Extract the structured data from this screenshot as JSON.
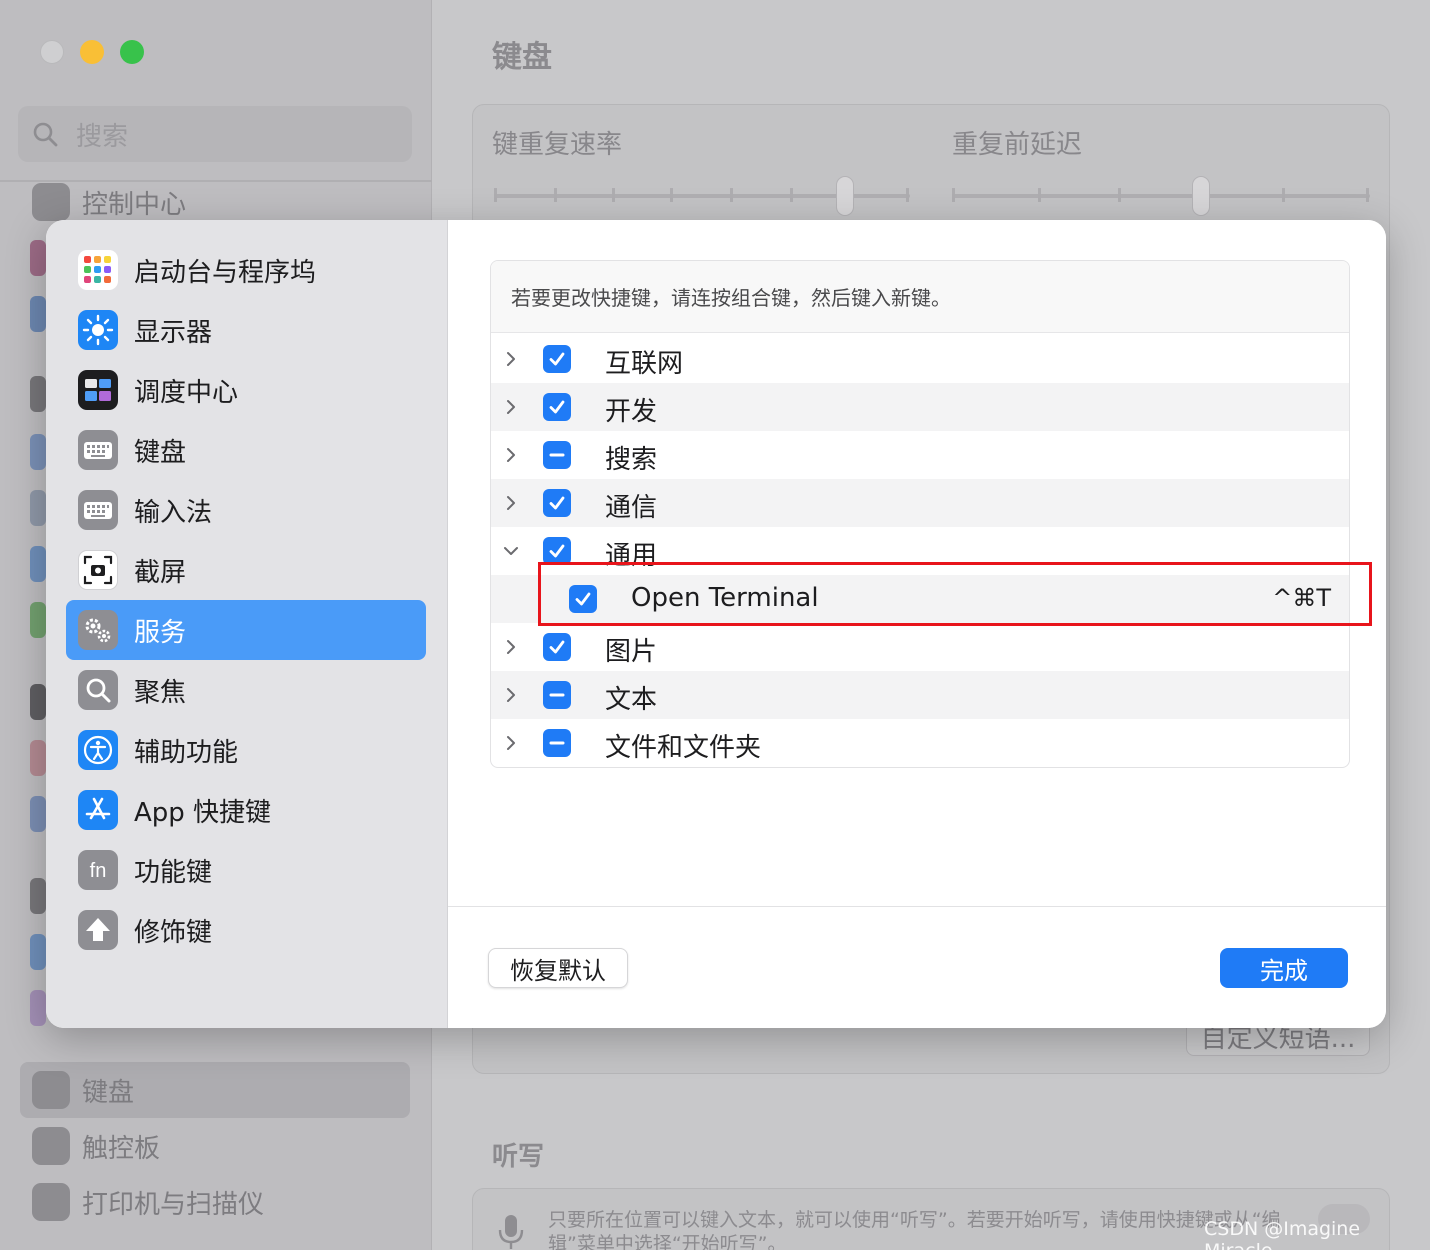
{
  "background": {
    "search_placeholder": "搜索",
    "sidebar_top_item": "控制中心",
    "sidebar_bottom_items": [
      "键盘",
      "触控板",
      "打印机与扫描仪"
    ],
    "title": "键盘",
    "key_repeat_label": "键重复速率",
    "repeat_delay_label": "重复前延迟",
    "text_replacement_button": "自定义短语...",
    "dictation_title": "听写",
    "dictation_text": "只要所在位置可以键入文本，就可以使用“听写”。若要开始听写，请使用快捷键或从“编辑”菜单中选择“开始听写”。",
    "watermark": "CSDN @Imagine Miracle"
  },
  "sidebar": {
    "items": [
      {
        "label": "启动台与程序坞",
        "icon": "launchpad-icon"
      },
      {
        "label": "显示器",
        "icon": "display-brightness-icon"
      },
      {
        "label": "调度中心",
        "icon": "mission-control-icon"
      },
      {
        "label": "键盘",
        "icon": "keyboard-icon"
      },
      {
        "label": "输入法",
        "icon": "input-method-icon"
      },
      {
        "label": "截屏",
        "icon": "screenshot-icon"
      },
      {
        "label": "服务",
        "icon": "services-gear-icon",
        "selected": true
      },
      {
        "label": "聚焦",
        "icon": "spotlight-icon"
      },
      {
        "label": "辅助功能",
        "icon": "accessibility-icon"
      },
      {
        "label": "App 快捷键",
        "icon": "app-store-icon"
      },
      {
        "label": "功能键",
        "icon": "fn-key-icon"
      },
      {
        "label": "修饰键",
        "icon": "modifier-key-icon"
      }
    ]
  },
  "main": {
    "hint": "若要更改快捷键，请连按组合键，然后键入新键。",
    "rows": [
      {
        "label": "互联网",
        "state": "checked",
        "expanded": false
      },
      {
        "label": "开发",
        "state": "checked",
        "expanded": false
      },
      {
        "label": "搜索",
        "state": "mixed",
        "expanded": false
      },
      {
        "label": "通信",
        "state": "checked",
        "expanded": false
      },
      {
        "label": "通用",
        "state": "checked",
        "expanded": true
      },
      {
        "label": "Open Terminal",
        "state": "checked",
        "shortcut": "^⌘T",
        "child": true
      },
      {
        "label": "图片",
        "state": "checked",
        "expanded": false
      },
      {
        "label": "文本",
        "state": "mixed",
        "expanded": false
      },
      {
        "label": "文件和文件夹",
        "state": "mixed",
        "expanded": false
      }
    ],
    "restore_button": "恢复默认",
    "done_button": "完成"
  },
  "colors": {
    "accent": "#1f7bf6",
    "sidebar_selected": "#4a9bf8",
    "highlight_box": "#e8141b"
  }
}
